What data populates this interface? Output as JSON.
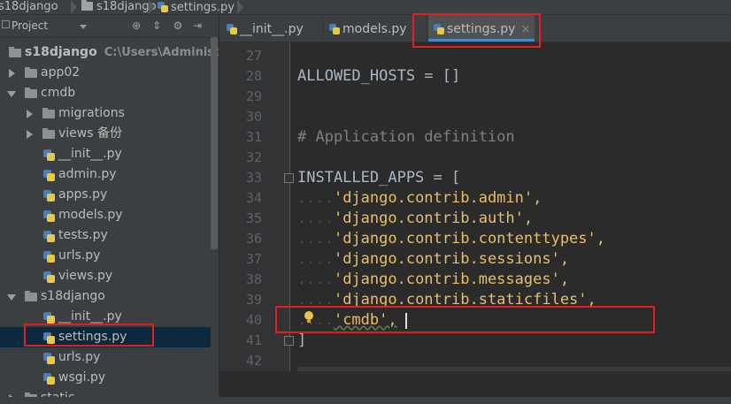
{
  "breadcrumb": {
    "items": [
      "s18django",
      "s18django",
      "settings.py"
    ]
  },
  "project_panel": {
    "title": "Project",
    "root": {
      "label": "s18django",
      "path": "C:\\Users\\Administrato"
    },
    "tree": [
      {
        "label": "app02",
        "type": "folder",
        "expanded": false
      },
      {
        "label": "cmdb",
        "type": "folder",
        "expanded": true
      },
      {
        "label": "migrations",
        "type": "folder",
        "expanded": false
      },
      {
        "label": "views 备份",
        "type": "folder",
        "expanded": false
      },
      {
        "label": "__init__.py",
        "type": "py"
      },
      {
        "label": "admin.py",
        "type": "py"
      },
      {
        "label": "apps.py",
        "type": "py"
      },
      {
        "label": "models.py",
        "type": "py"
      },
      {
        "label": "tests.py",
        "type": "py"
      },
      {
        "label": "urls.py",
        "type": "py"
      },
      {
        "label": "views.py",
        "type": "py"
      },
      {
        "label": "s18django",
        "type": "folder",
        "expanded": true
      },
      {
        "label": "__init__.py",
        "type": "py"
      },
      {
        "label": "settings.py",
        "type": "py",
        "selected": true
      },
      {
        "label": "urls.py",
        "type": "py"
      },
      {
        "label": "wsgi.py",
        "type": "py"
      },
      {
        "label": "static",
        "type": "folder"
      }
    ]
  },
  "tabs": [
    {
      "label": "__init__.py",
      "active": false
    },
    {
      "label": "models.py",
      "active": false
    },
    {
      "label": "settings.py",
      "active": true,
      "close": "×"
    }
  ],
  "editor": {
    "lines": [
      {
        "n": "27",
        "code": ""
      },
      {
        "n": "28",
        "code": "ALLOWED_HOSTS = []"
      },
      {
        "n": "29",
        "code": ""
      },
      {
        "n": "30",
        "code": ""
      },
      {
        "n": "31",
        "code": "# Application definition"
      },
      {
        "n": "32",
        "code": ""
      },
      {
        "n": "33",
        "code": "INSTALLED_APPS = ["
      },
      {
        "n": "34",
        "code": "'django.contrib.admin',"
      },
      {
        "n": "35",
        "code": "'django.contrib.auth',"
      },
      {
        "n": "36",
        "code": "'django.contrib.contenttypes',"
      },
      {
        "n": "37",
        "code": "'django.contrib.sessions',"
      },
      {
        "n": "38",
        "code": "'django.contrib.messages',"
      },
      {
        "n": "39",
        "code": "'django.contrib.staticfiles',"
      },
      {
        "n": "40",
        "code": "'cmdb',"
      },
      {
        "n": "41",
        "code": "]"
      },
      {
        "n": "42",
        "code": ""
      }
    ],
    "indent_dots": "....",
    "colors": {
      "keyword_text": "#a9b7c6",
      "string": "#e8bf6a",
      "comment": "#808080",
      "line_number": "#606366"
    }
  },
  "annotation_color": "#e02020"
}
